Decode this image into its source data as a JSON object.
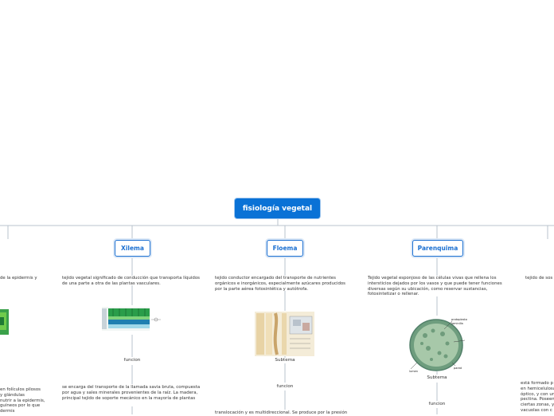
{
  "root": {
    "title": "fisiología vegetal"
  },
  "branches": [
    {
      "id": "xilema",
      "title": "Xilema",
      "description": "tejido vegetal significado de conducción que transporta líquidos de una parte a otra de las plantas vasculares.",
      "sublabel": "funcion",
      "detail": "se encarga del transporte de la llamada savia bruta, compuesta por agua y sales minerales provenientes de la raíz. La madera, principal tejido de soporte mecánico en la mayoría de plantas"
    },
    {
      "id": "floema",
      "title": "Floema",
      "description": "tejido conductor encargado del transporte de nutrientes orgánicos e inorgánicos, especialmente azúcares producidos por la parte aérea fotosintética y autótrofa.",
      "sublabel1": "Subtema",
      "sublabel2": "funcion",
      "detail": "translocación y es multidireccional. Se produce por la presión"
    },
    {
      "id": "parenquima",
      "title": "Parenquima",
      "description": "Tejido vegetal esponjoso de las células vivas que rellena los intersticios dejados por los vasos y que puede tener funciones diversas según su ubicación, como reservar sustancias, fotosintetizar o rellenar.",
      "sublabel1": "Subtema",
      "sublabel2": "funcion",
      "image_labels": [
        "protoplasto",
        "laminilla",
        "lumen",
        "pared"
      ]
    }
  ],
  "left_partial": {
    "top_text": "de la epidermis y",
    "bottom_text": [
      "en folículos pilosos",
      "y glándulas",
      "nutrir a la epidermis,",
      "guíneos por lo que",
      "dermis"
    ]
  },
  "right_partial": {
    "top_text": "tejido de sos",
    "bottom_text": [
      "está formado p",
      "en hemicelulosa",
      "óptico, y con un",
      "pectina. Poseen",
      "ciertas zonas, y",
      "vacuolas con c"
    ]
  },
  "colors": {
    "root_bg": "#0a72d6",
    "branch_border": "#1c70d1",
    "line": "#b9c3cc",
    "text": "#333333"
  }
}
